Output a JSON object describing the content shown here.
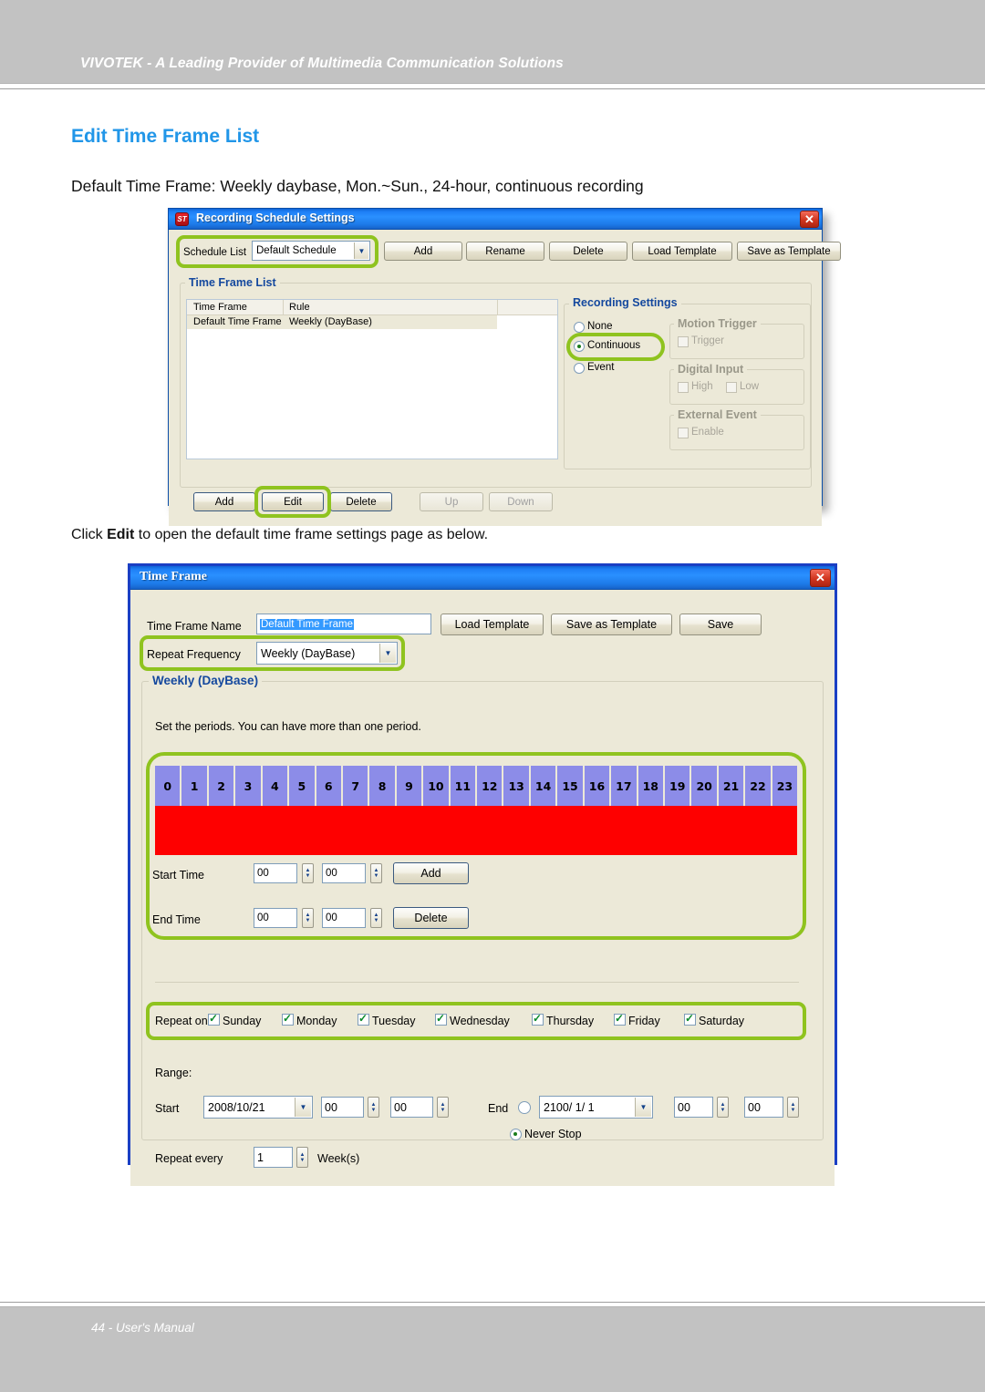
{
  "page": {
    "header_banner": "VIVOTEK - A Leading Provider of Multimedia Communication Solutions",
    "footer": "44 - User's Manual",
    "title": "Edit Time Frame List",
    "intro": "Default Time Frame: Weekly daybase, Mon.~Sun., 24-hour, continuous recording",
    "mid_text_before": "Click ",
    "mid_text_bold": "Edit",
    "mid_text_after": " to open the default time frame settings page as below."
  },
  "schedule_dialog": {
    "title": "Recording Schedule Settings",
    "icon_label": "ST",
    "close_label": "✕",
    "schedule_list_label": "Schedule List",
    "schedule_list_value": "Default Schedule",
    "buttons": {
      "add": "Add",
      "rename": "Rename",
      "delete": "Delete",
      "load_template": "Load Template",
      "save_as_template": "Save as Template"
    },
    "time_frame_list_group": "Time Frame List",
    "columns": [
      "Time Frame",
      "Rule"
    ],
    "rows": [
      {
        "time_frame": "Default Time Frame",
        "rule": "Weekly (DayBase)"
      }
    ],
    "recording_settings": {
      "group": "Recording Settings",
      "mode_options": [
        "None",
        "Continuous",
        "Event"
      ],
      "selected_mode": "Continuous",
      "motion_trigger": {
        "group": "Motion Trigger",
        "trigger_label": "Trigger",
        "trigger_checked": false
      },
      "digital_input": {
        "group": "Digital Input",
        "high_label": "High",
        "low_label": "Low",
        "high_checked": false,
        "low_checked": false
      },
      "external_event": {
        "group": "External Event",
        "enable_label": "Enable",
        "enable_checked": false
      }
    },
    "bottom_buttons": {
      "add": "Add",
      "edit": "Edit",
      "delete": "Delete",
      "up": "Up",
      "down": "Down"
    }
  },
  "timeframe_dialog": {
    "title": "Time Frame",
    "close_label": "✕",
    "name_label": "Time Frame Name",
    "name_value": "Default Time Frame",
    "buttons": {
      "load_template": "Load Template",
      "save_as_template": "Save as Template",
      "save": "Save"
    },
    "repeat_frequency_label": "Repeat Frequency",
    "repeat_frequency_value": "Weekly (DayBase)",
    "weekly_group": "Weekly (DayBase)",
    "hint": "Set the periods. You can have more than one period.",
    "hours": [
      "0",
      "1",
      "2",
      "3",
      "4",
      "5",
      "6",
      "7",
      "8",
      "9",
      "10",
      "11",
      "12",
      "13",
      "14",
      "15",
      "16",
      "17",
      "18",
      "19",
      "20",
      "21",
      "22",
      "23"
    ],
    "start_time_label": "Start Time",
    "start_time_hour": "00",
    "start_time_minute": "00",
    "add_button": "Add",
    "end_time_label": "End Time",
    "end_time_hour": "00",
    "end_time_minute": "00",
    "delete_button": "Delete",
    "repeat_on_label": "Repeat on",
    "days": [
      {
        "label": "Sunday",
        "checked": true
      },
      {
        "label": "Monday",
        "checked": true
      },
      {
        "label": "Tuesday",
        "checked": true
      },
      {
        "label": "Wednesday",
        "checked": true
      },
      {
        "label": "Thursday",
        "checked": true
      },
      {
        "label": "Friday",
        "checked": true
      },
      {
        "label": "Saturday",
        "checked": true
      }
    ],
    "range_label": "Range:",
    "start_label": "Start",
    "start_date": "2008/10/21",
    "start_hour": "00",
    "start_minute": "00",
    "end_label": "End",
    "end_date": "2100/ 1/ 1",
    "end_hour": "00",
    "end_minute": "00",
    "never_stop_label": "Never Stop",
    "never_stop_selected": true,
    "repeat_every_label": "Repeat every",
    "repeat_every_value": "1",
    "repeat_every_unit": "Week(s)"
  },
  "colors": {
    "highlight_green": "#8fc31f",
    "accent_blue": "#2196e8",
    "hour_cell": "#8c8ce8",
    "period_red": "#fe0000",
    "dialog_face": "#ece9d8",
    "band_gray": "#c2c2c2"
  }
}
